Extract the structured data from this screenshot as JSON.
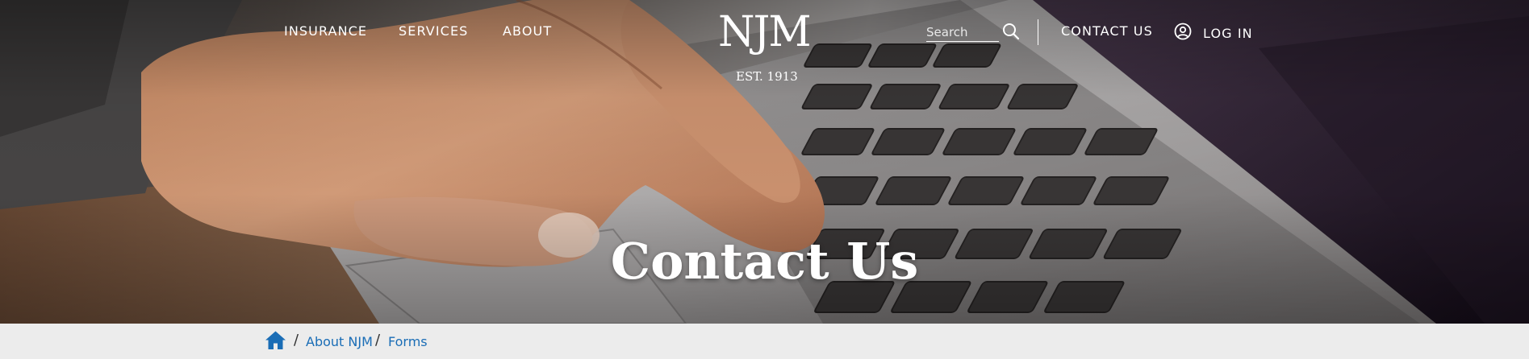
{
  "nav": {
    "insurance": "INSURANCE",
    "services": "SERVICES",
    "about": "ABOUT",
    "contact": "CONTACT US",
    "login": "LOG IN"
  },
  "logo": {
    "name": "NJM",
    "tagline": "EST. 1913"
  },
  "search": {
    "placeholder": "Search",
    "icon": "search-icon"
  },
  "hero": {
    "title": "Contact Us",
    "image": "hand-on-laptop-keyboard"
  },
  "breadcrumb": {
    "home_icon": "home-icon",
    "separator": "/",
    "items": [
      "About NJM",
      "Forms"
    ]
  },
  "colors": {
    "link": "#1a6db6",
    "breadcrumb_bg": "#ececec",
    "header_text": "#ffffff"
  }
}
